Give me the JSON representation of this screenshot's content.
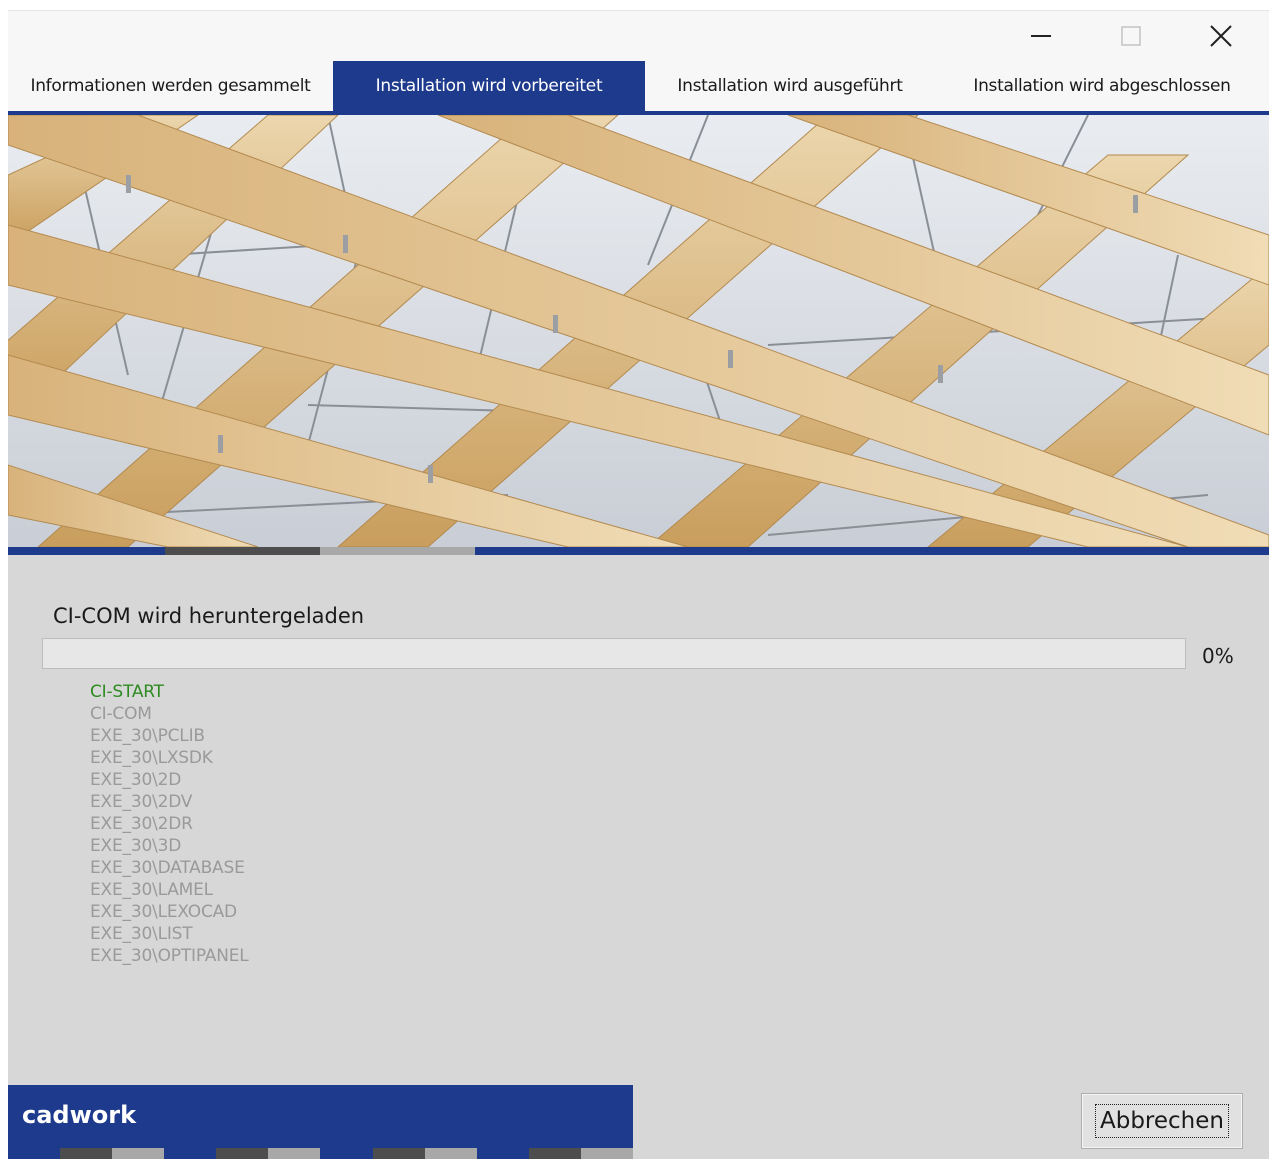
{
  "window": {
    "controls": {
      "minimize_icon": "minimize-icon",
      "maximize_icon": "maximize-icon",
      "close_icon": "close-icon"
    }
  },
  "tabs": [
    {
      "label": "Informationen werden gesammelt",
      "active": false
    },
    {
      "label": "Installation wird vorbereitet",
      "active": true
    },
    {
      "label": "Installation wird ausgeführt",
      "active": false
    },
    {
      "label": "Installation wird abgeschlossen",
      "active": false
    }
  ],
  "status": {
    "title": "CI-COM wird heruntergeladen",
    "progress_percent": 0,
    "progress_label": "0%"
  },
  "components": [
    {
      "label": "CI-START",
      "state": "done"
    },
    {
      "label": "CI-COM",
      "state": "pending"
    },
    {
      "label": "EXE_30\\PCLIB",
      "state": "pending"
    },
    {
      "label": "EXE_30\\LXSDK",
      "state": "pending"
    },
    {
      "label": "EXE_30\\2D",
      "state": "pending"
    },
    {
      "label": "EXE_30\\2DV",
      "state": "pending"
    },
    {
      "label": "EXE_30\\2DR",
      "state": "pending"
    },
    {
      "label": "EXE_30\\3D",
      "state": "pending"
    },
    {
      "label": "EXE_30\\DATABASE",
      "state": "pending"
    },
    {
      "label": "EXE_30\\LAMEL",
      "state": "pending"
    },
    {
      "label": "EXE_30\\LEXOCAD",
      "state": "pending"
    },
    {
      "label": "EXE_30\\LIST",
      "state": "pending"
    },
    {
      "label": "EXE_30\\OPTIPANEL",
      "state": "pending"
    }
  ],
  "footer": {
    "brand": "cadwork",
    "cancel_label": "Abbrechen"
  },
  "colors": {
    "brand_blue": "#1d3a8c",
    "active_component": "#2e8b22",
    "pending_component": "#9a9a9a",
    "dark_gray": "#4d4d4d",
    "light_gray": "#a8a8a8"
  }
}
